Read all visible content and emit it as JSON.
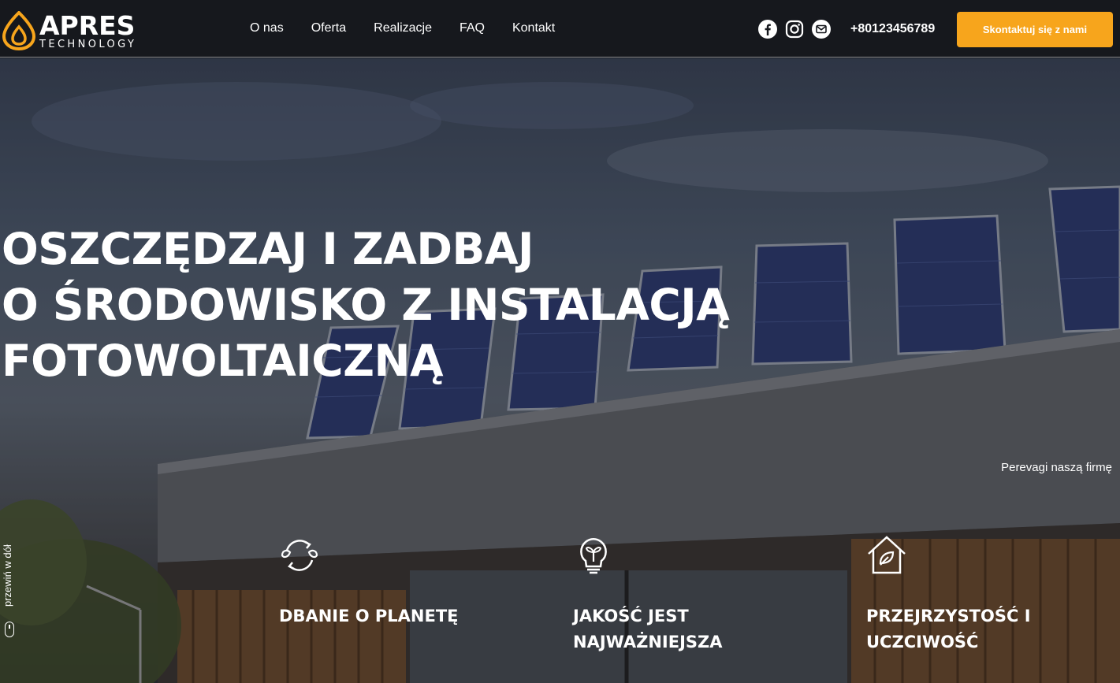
{
  "brand": {
    "name": "APRES",
    "tagline": "TECHNOLOGY",
    "accent": "#f7a51c"
  },
  "nav": {
    "items": [
      {
        "label": "O nas"
      },
      {
        "label": "Oferta"
      },
      {
        "label": "Realizacje"
      },
      {
        "label": "FAQ"
      },
      {
        "label": "Kontakt"
      }
    ]
  },
  "social": {
    "icons": [
      "facebook-icon",
      "instagram-icon",
      "mail-icon"
    ]
  },
  "contact": {
    "phone": "+80123456789",
    "cta_label": "Skontaktuj się z nami"
  },
  "hero": {
    "headline": [
      "OSZCZĘDZAJ I ZADBAJ",
      "O ŚRODOWISKO Z INSTALACJĄ",
      "FOTOWOLTAICZNĄ"
    ],
    "advantages_link": "Perevagi naszą firmę",
    "scroll_hint": "przewiń w dół"
  },
  "features": [
    {
      "icon": "planet-cycle-icon",
      "title": "DBANIE O PLANETĘ"
    },
    {
      "icon": "eco-bulb-icon",
      "title": "JAKOŚĆ JEST NAJWAŻNIEJSZA"
    },
    {
      "icon": "eco-house-icon",
      "title": "PRZEJRZYSTOŚĆ I UCZCIWOŚĆ"
    }
  ]
}
